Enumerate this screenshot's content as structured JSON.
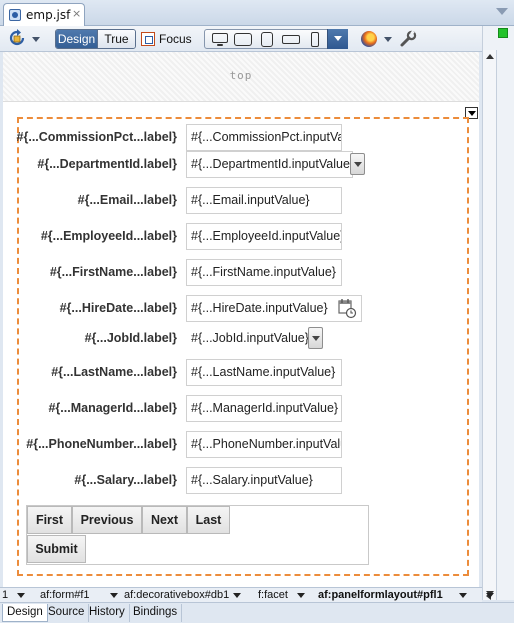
{
  "editor_tab": {
    "title": "emp.jsf",
    "close": "×"
  },
  "toolbar": {
    "design_label": "Design",
    "true_label": "True",
    "focus_label": "Focus",
    "icons": [
      "refresh-icon",
      "focus-icon",
      "desktop-icon",
      "tablet-landscape-icon",
      "tablet-portrait-icon",
      "phone-landscape-icon",
      "phone-portrait-icon",
      "firefox-icon",
      "wrench-icon"
    ]
  },
  "top_facet": {
    "label": "top"
  },
  "form": {
    "fields": [
      {
        "label": "#{...CommissionPct...label}",
        "value": "#{...CommissionPct.inputValue}",
        "control": "text"
      },
      {
        "label": "#{...DepartmentId.label}",
        "value": "#{...DepartmentId.inputValue}",
        "control": "select"
      },
      {
        "label": "#{...Email...label}",
        "value": "#{...Email.inputValue}",
        "control": "text"
      },
      {
        "label": "#{...EmployeeId...label}",
        "value": "#{...EmployeeId.inputValue}",
        "control": "text"
      },
      {
        "label": "#{...FirstName...label}",
        "value": "#{...FirstName.inputValue}",
        "control": "text"
      },
      {
        "label": "#{...HireDate...label}",
        "value": "#{...HireDate.inputValue}",
        "control": "date"
      },
      {
        "label": "#{...JobId.label}",
        "value": "#{...JobId.inputValue}",
        "control": "select"
      },
      {
        "label": "#{...LastName...label}",
        "value": "#{...LastName.inputValue}",
        "control": "text"
      },
      {
        "label": "#{...ManagerId...label}",
        "value": "#{...ManagerId.inputValue}",
        "control": "text"
      },
      {
        "label": "#{...PhoneNumber...label}",
        "value": "#{...PhoneNumber.inputValue}",
        "control": "text"
      },
      {
        "label": "#{...Salary...label}",
        "value": "#{...Salary.inputValue}",
        "control": "text"
      }
    ],
    "nav_buttons": [
      "First",
      "Previous",
      "Next",
      "Last"
    ],
    "submit_label": "Submit"
  },
  "breadcrumbs": [
    "1",
    "af:form#f1",
    "af:decorativebox#db1",
    "f:facet",
    "af:panelformlayout#pfl1"
  ],
  "bottom_tabs": [
    {
      "label": "Design",
      "active": true
    },
    {
      "label": "Source",
      "active": false
    },
    {
      "label": "History",
      "active": false
    },
    {
      "label": "Bindings",
      "active": false
    }
  ],
  "colors": {
    "accent": "#345f95",
    "layout_outline": "#ec8c3b",
    "status_ok": "#23c22b"
  }
}
